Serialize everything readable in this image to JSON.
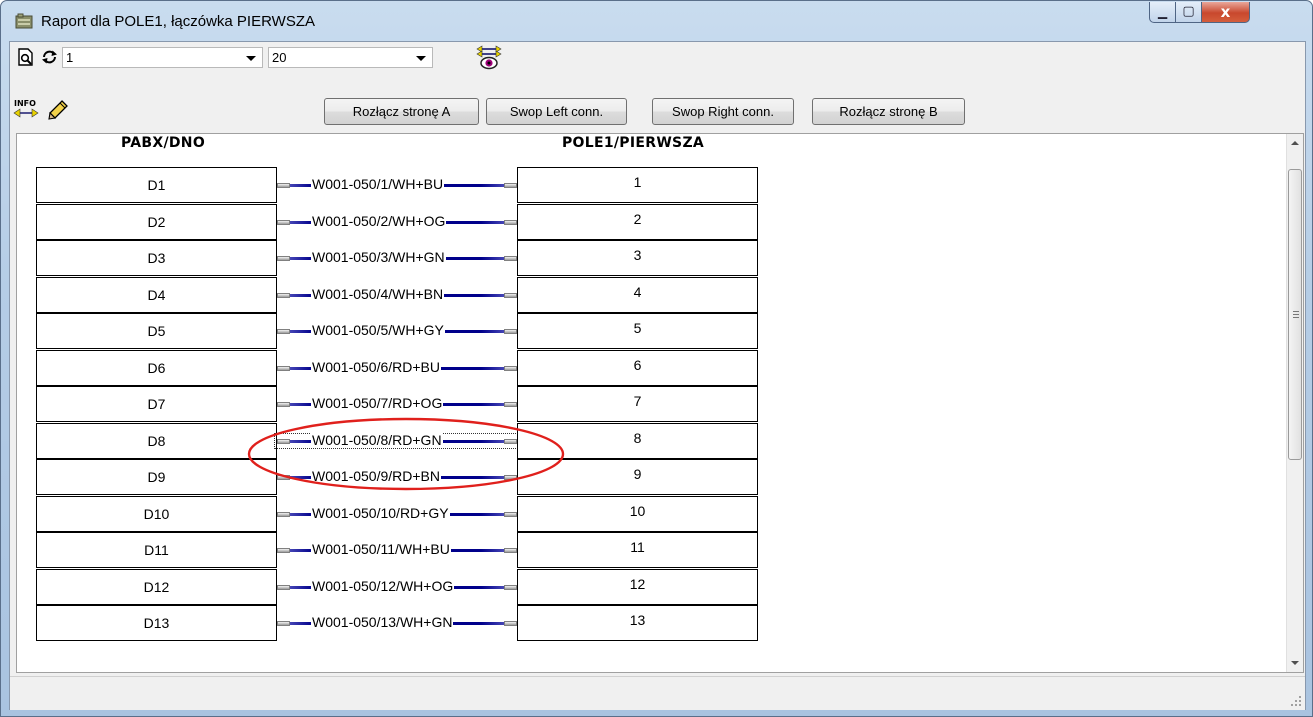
{
  "window": {
    "title": "Raport dla POLE1, łączówka PIERWSZA",
    "controls": {
      "minimize": "▁",
      "maximize": "▢",
      "close": "x"
    }
  },
  "toolbar1": {
    "page_combo": {
      "value": "1"
    },
    "count_combo": {
      "value": "20"
    },
    "icons": [
      "print-preview-icon",
      "refresh-icon",
      "view-eye-icon"
    ]
  },
  "toolbar2": {
    "info_icon_label": "INFO",
    "buttons": {
      "disconnect_a": "Rozłącz stronę A",
      "swop_left": "Swop Left conn.",
      "swop_right": "Swop Right conn.",
      "disconnect_b": "Rozłącz stronę B"
    }
  },
  "report": {
    "left_header": "PABX/DNO",
    "right_header": "POLE1/PIERWSZA",
    "selected_row": 7,
    "rows": [
      {
        "left": "D1",
        "wire": "W001-050/1/WH+BU",
        "right": "1"
      },
      {
        "left": "D2",
        "wire": "W001-050/2/WH+OG",
        "right": "2"
      },
      {
        "left": "D3",
        "wire": "W001-050/3/WH+GN",
        "right": "3"
      },
      {
        "left": "D4",
        "wire": "W001-050/4/WH+BN",
        "right": "4"
      },
      {
        "left": "D5",
        "wire": "W001-050/5/WH+GY",
        "right": "5"
      },
      {
        "left": "D6",
        "wire": "W001-050/6/RD+BU",
        "right": "6"
      },
      {
        "left": "D7",
        "wire": "W001-050/7/RD+OG",
        "right": "7"
      },
      {
        "left": "D8",
        "wire": "W001-050/8/RD+GN",
        "right": "8"
      },
      {
        "left": "D9",
        "wire": "W001-050/9/RD+BN",
        "right": "9"
      },
      {
        "left": "D10",
        "wire": "W001-050/10/RD+GY",
        "right": "10"
      },
      {
        "left": "D11",
        "wire": "W001-050/11/WH+BU",
        "right": "11"
      },
      {
        "left": "D12",
        "wire": "W001-050/12/WH+OG",
        "right": "12"
      },
      {
        "left": "D13",
        "wire": "W001-050/13/WH+GN",
        "right": "13"
      }
    ]
  },
  "colors": {
    "wire": "#00008b",
    "highlight": "#e0201c"
  }
}
